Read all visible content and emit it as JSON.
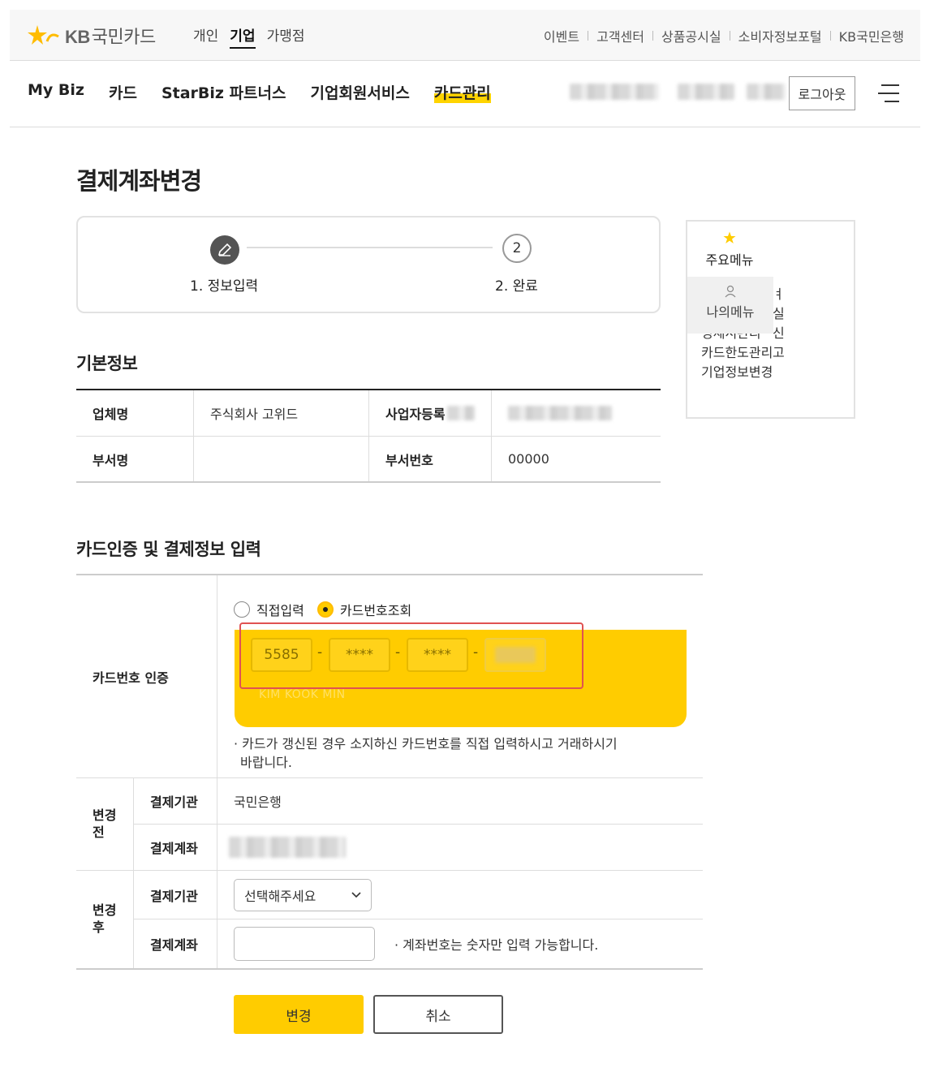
{
  "brand": {
    "logo_text": "국민카드",
    "logo_prefix": "KB",
    "accent": "#ffcc00",
    "accent_dark": "#e6b800"
  },
  "segment_nav": [
    "개인",
    "기업",
    "가맹점"
  ],
  "segment_active": "기업",
  "utility_links": [
    "이벤트",
    "고객센터",
    "상품공시실",
    "소비자정보포털",
    "KB국민은행"
  ],
  "main_nav": [
    "My Biz",
    "카드",
    "StarBiz 파트너스",
    "기업회원서비스",
    "카드관리"
  ],
  "main_nav_active": "카드관리",
  "user_area": {
    "logout_label": "로그아웃",
    "menu_icon": "hamburger-menu-icon"
  },
  "page_title": "결제계좌변경",
  "steps": [
    {
      "number": "1",
      "label": "1. 정보입력",
      "state": "current",
      "icon": "pencil-icon"
    },
    {
      "number": "2",
      "label": "2. 완료",
      "state": "pending"
    }
  ],
  "basic_info": {
    "title": "기본정보",
    "rows": [
      {
        "h1": "업체명",
        "v1": "주식회사 고위드",
        "h2": "사업자등록",
        "v2": ""
      },
      {
        "h1": "부서명",
        "v1": "",
        "h2": "부서번호",
        "v2": "00000"
      }
    ]
  },
  "card_section": {
    "title": "카드인증 및 결제정보 입력",
    "card_auth_label": "카드번호 인증",
    "radio_options": [
      {
        "label": "직접입력",
        "checked": false
      },
      {
        "label": "카드번호조회",
        "checked": true
      }
    ],
    "card_numbers": [
      "5585",
      "****",
      "****",
      ""
    ],
    "card_holder": "KIM KOOK MIN",
    "card_note": "· 카드가 갱신된 경우 소지하신 카드번호를 직접 입력하시고 거래하시기",
    "card_note_2": "바랍니다.",
    "before": {
      "group_label_1": "변경",
      "group_label_2": "전",
      "institution_label": "결제기관",
      "institution_value": "국민은행",
      "account_label": "결제계좌",
      "account_value": ""
    },
    "after": {
      "group_label_1": "변경",
      "group_label_2": "후",
      "institution_label": "결제기관",
      "institution_placeholder": "선택해주세요",
      "account_label": "결제계좌",
      "account_value": "",
      "account_note": "· 계좌번호는 숫자만 입력 가능합니다."
    }
  },
  "buttons": {
    "submit": "변경",
    "cancel": "취소"
  },
  "side_panel": {
    "favorites_label": "주요메뉴",
    "my_menu_label": "나의메뉴",
    "items": [
      "",
      "",
      "명세서관리",
      "카드한도관리",
      "기업정보변경"
    ],
    "partial_item_1": "ㅕ",
    "partial_item_2": "실신고"
  }
}
